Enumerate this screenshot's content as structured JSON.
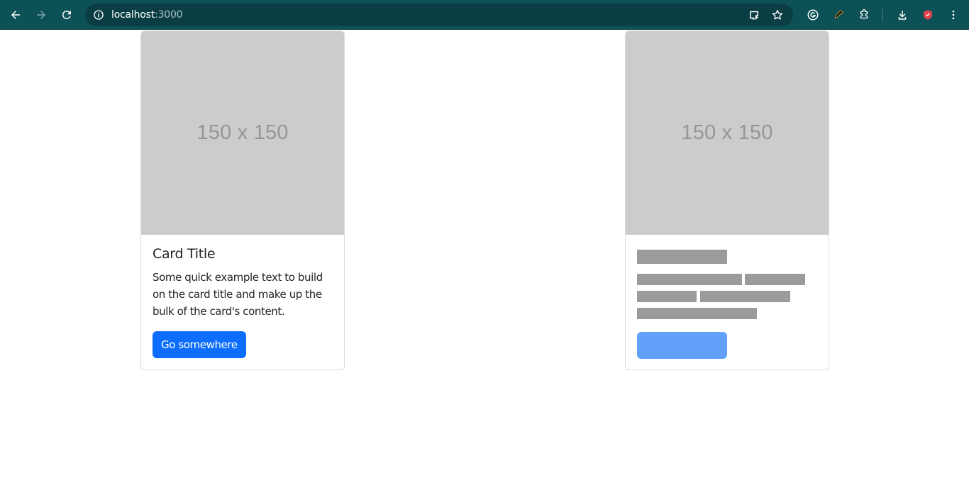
{
  "browser": {
    "url_host": "localhost",
    "url_port": ":3000"
  },
  "cards": [
    {
      "image_text": "150 x 150",
      "title": "Card Title",
      "text": "Some quick example text to build on the card title and make up the bulk of the card's content.",
      "button_label": "Go somewhere"
    },
    {
      "image_text": "150 x 150",
      "placeholder": true
    }
  ],
  "colors": {
    "toolbar": "#0b5156",
    "primary_button": "#0d6efd",
    "placeholder_button": "#62a1fb",
    "placeholder_bar": "#9a9b9c",
    "image_bg": "#cccccc"
  }
}
